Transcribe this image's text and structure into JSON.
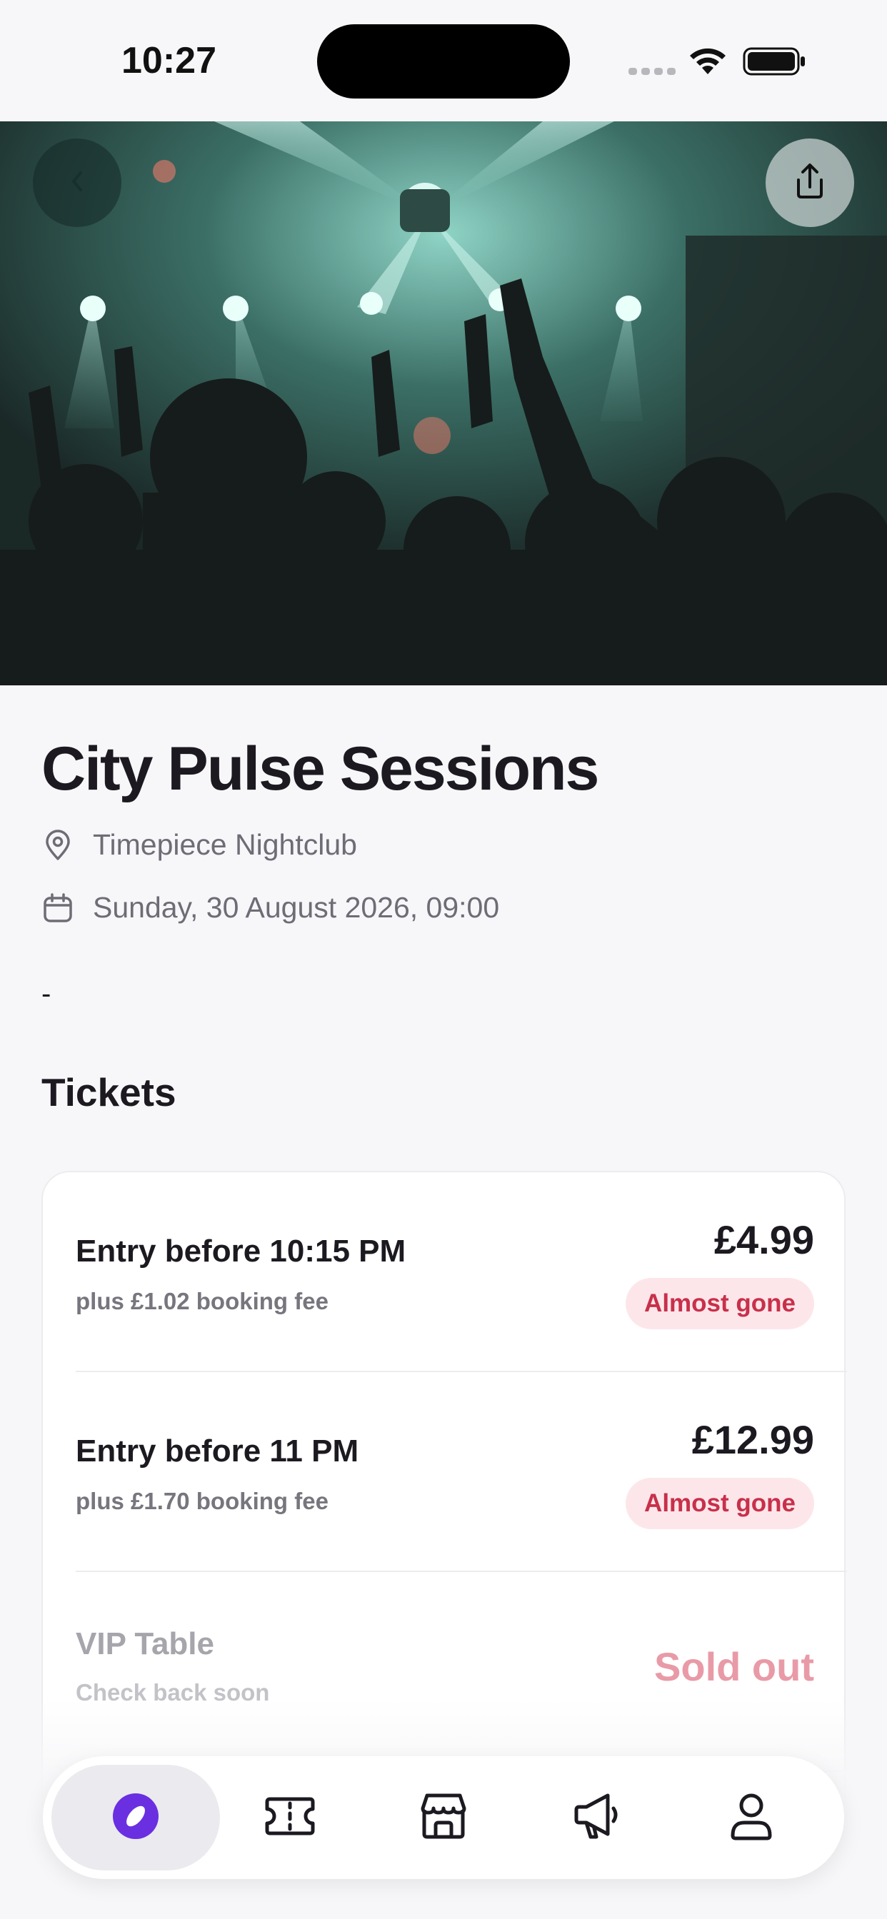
{
  "status_bar": {
    "time": "10:27"
  },
  "event": {
    "title": "City Pulse Sessions",
    "venue": "Timepiece Nightclub",
    "datetime": "Sunday, 30 August 2026, 09:00",
    "description": "-"
  },
  "tickets_section": {
    "title": "Tickets",
    "items": [
      {
        "name": "Entry before 10:15 PM",
        "fee": "plus £1.02 booking fee",
        "price": "£4.99",
        "badge": "Almost gone"
      },
      {
        "name": "Entry before 11 PM",
        "fee": "plus £1.70 booking fee",
        "price": "£12.99",
        "badge": "Almost gone"
      },
      {
        "name": "VIP Table",
        "fee": "Check back soon",
        "status": "Sold out"
      }
    ]
  },
  "icons": {
    "back": "chevron-left-icon",
    "share": "share-icon",
    "venue": "map-pin-icon",
    "date": "calendar-icon",
    "nav": [
      "discover-icon",
      "ticket-icon",
      "store-icon",
      "megaphone-icon",
      "profile-icon"
    ]
  },
  "colors": {
    "accent": "#6a2fe0",
    "badge_bg": "#fde6ea",
    "badge_text": "#c8304a",
    "sold_out": "#e99aa7"
  }
}
